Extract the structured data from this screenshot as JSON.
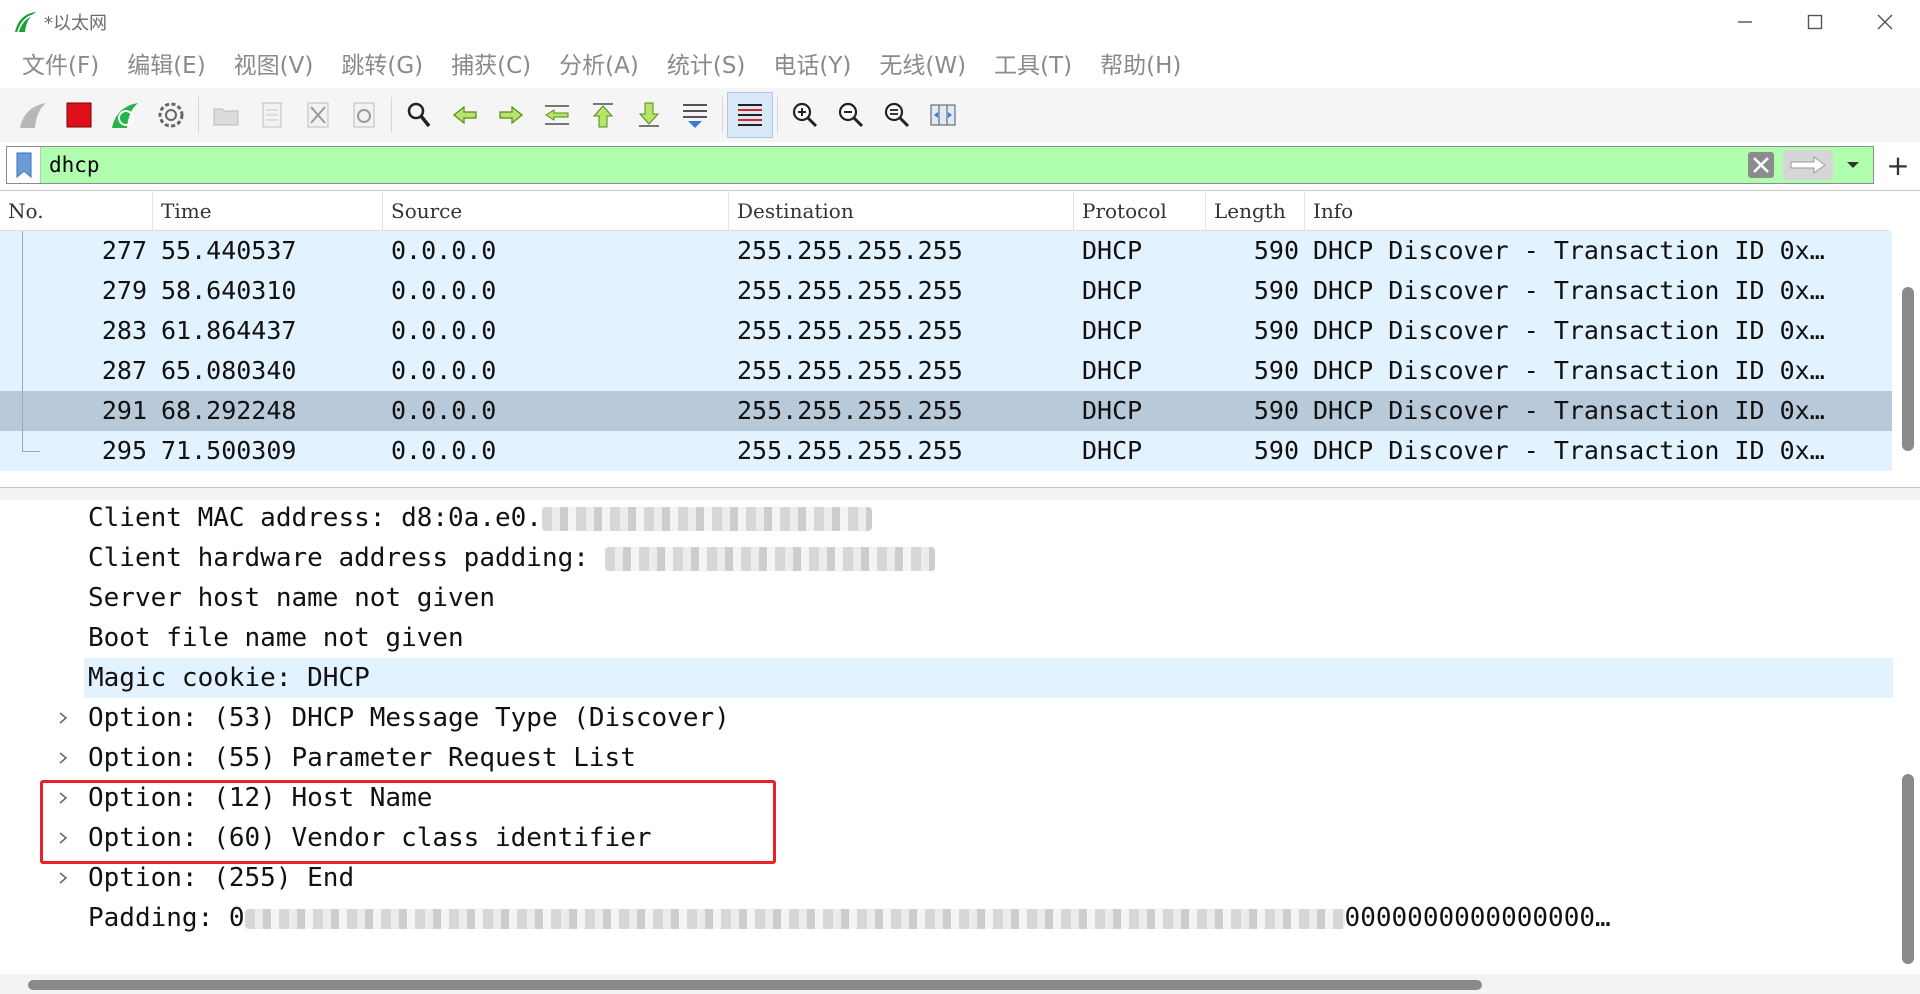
{
  "window": {
    "title": "*以太网"
  },
  "menu": [
    {
      "label": "文件(F)"
    },
    {
      "label": "编辑(E)"
    },
    {
      "label": "视图(V)"
    },
    {
      "label": "跳转(G)"
    },
    {
      "label": "捕获(C)"
    },
    {
      "label": "分析(A)"
    },
    {
      "label": "统计(S)"
    },
    {
      "label": "电话(Y)"
    },
    {
      "label": "无线(W)"
    },
    {
      "label": "工具(T)"
    },
    {
      "label": "帮助(H)"
    }
  ],
  "filter": {
    "value": "dhcp",
    "background_color": "#afffaf"
  },
  "packet_list": {
    "columns": [
      "No.",
      "Time",
      "Source",
      "Destination",
      "Protocol",
      "Length",
      "Info"
    ],
    "rows": [
      {
        "no": "277",
        "time": "55.440537",
        "source": "0.0.0.0",
        "destination": "255.255.255.255",
        "protocol": "DHCP",
        "length": "590",
        "info": "DHCP Discover - Transaction ID 0x…"
      },
      {
        "no": "279",
        "time": "58.640310",
        "source": "0.0.0.0",
        "destination": "255.255.255.255",
        "protocol": "DHCP",
        "length": "590",
        "info": "DHCP Discover - Transaction ID 0x…"
      },
      {
        "no": "283",
        "time": "61.864437",
        "source": "0.0.0.0",
        "destination": "255.255.255.255",
        "protocol": "DHCP",
        "length": "590",
        "info": "DHCP Discover - Transaction ID 0x…"
      },
      {
        "no": "287",
        "time": "65.080340",
        "source": "0.0.0.0",
        "destination": "255.255.255.255",
        "protocol": "DHCP",
        "length": "590",
        "info": "DHCP Discover - Transaction ID 0x…"
      },
      {
        "no": "291",
        "time": "68.292248",
        "source": "0.0.0.0",
        "destination": "255.255.255.255",
        "protocol": "DHCP",
        "length": "590",
        "info": "DHCP Discover - Transaction ID 0x…"
      },
      {
        "no": "295",
        "time": "71.500309",
        "source": "0.0.0.0",
        "destination": "255.255.255.255",
        "protocol": "DHCP",
        "length": "590",
        "info": "DHCP Discover - Transaction ID 0x…"
      }
    ],
    "selected_row": 4,
    "row_color": "#e3f2ff",
    "selected_color": "#b8c9d9"
  },
  "details": {
    "client_mac_label": "Client MAC address: ",
    "client_mac_visible": "d8:0a.e0.",
    "client_hw_padding_label": "Client hardware address padding: ",
    "server_host": "Server host name not given",
    "boot_file": "Boot file name not given",
    "magic_cookie": "Magic cookie: DHCP",
    "opt53": "Option: (53) DHCP Message Type (Discover)",
    "opt55": "Option: (55) Parameter Request List",
    "opt12": "Option: (12) Host Name",
    "opt60": "Option: (60) Vendor class identifier",
    "opt255": "Option: (255) End",
    "padding_label": "Padding: 0",
    "padding_tail": "0000000000000000…",
    "highlight_box_color": "#e8202a"
  }
}
